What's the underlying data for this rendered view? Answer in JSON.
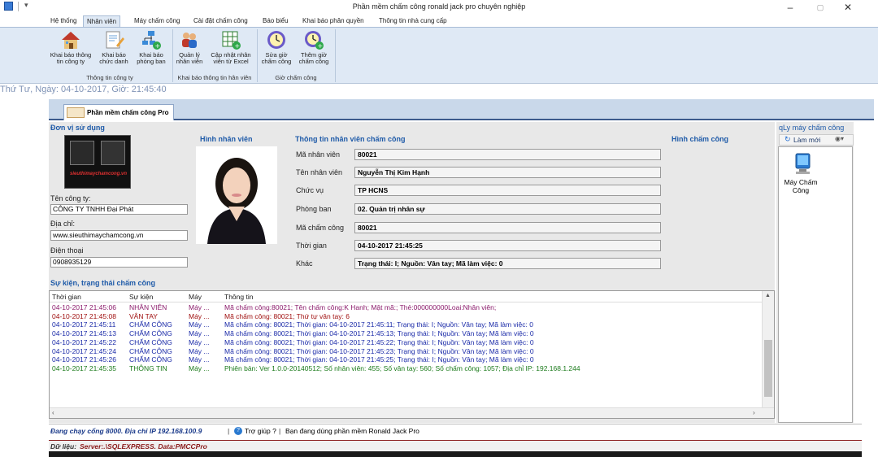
{
  "window": {
    "title": "Phần mềm chấm công ronald jack pro chuyên nghiệp",
    "minimize": "–",
    "maximize": "▢",
    "close": "✕"
  },
  "ribbon_tabs": [
    "Hệ thống",
    "Nhân viên",
    "Máy chấm công",
    "Cài đặt chấm công",
    "Báo biểu",
    "Khai báo phân quyền",
    "Thông tin nhà cung cấp"
  ],
  "ribbon": {
    "groups": [
      {
        "label": "Thông tin công ty",
        "buttons": [
          {
            "label1": "Khai báo thông",
            "label2": "tin công ty",
            "icon": "house-icon"
          },
          {
            "label1": "Khai báo",
            "label2": "chức danh",
            "icon": "edit-doc-icon"
          },
          {
            "label1": "Khai báo",
            "label2": "phòng ban",
            "icon": "org-chart-icon"
          }
        ]
      },
      {
        "label": "Khai báo thông tin hân viên",
        "buttons": [
          {
            "label1": "Quản lý",
            "label2": "nhân viên",
            "icon": "people-icon"
          },
          {
            "label1": "Cập nhật nhân",
            "label2": "viên từ Excel",
            "icon": "excel-icon"
          }
        ]
      },
      {
        "label": "Giờ chấm công",
        "buttons": [
          {
            "label1": "Sửa giờ",
            "label2": "chấm công",
            "icon": "clock-edit-icon"
          },
          {
            "label1": "Thêm giờ",
            "label2": "chấm công",
            "icon": "clock-add-icon"
          }
        ]
      }
    ]
  },
  "datetime": "Thứ Tư, Ngày: 04-10-2017, Giờ: 21:45:40",
  "doc_tab": "Phần mềm chấm công Pro",
  "company": {
    "section_title": "Đơn vị sử dụng",
    "logo_caption": "sieuthimaychamcong.vn",
    "name_label": "Tên công ty:",
    "name": "CÔNG TY TNHH Đại Phát",
    "address_label": "Địa chỉ:",
    "address": "www.sieuthimaychamcong.vn",
    "phone_label": "Điện thoại",
    "phone": "0908935129"
  },
  "employee_photo_title": "Hình nhân viên",
  "info": {
    "title": "Thông tin nhân viên chấm công",
    "fields": [
      {
        "label": "Mã nhân viên",
        "value": "80021"
      },
      {
        "label": "Tên nhân viên",
        "value": "Nguyễn Thị Kim Hạnh"
      },
      {
        "label": "Chức vụ",
        "value": "TP HCNS"
      },
      {
        "label": "Phòng ban",
        "value": "02. Quản trị nhân sự"
      },
      {
        "label": "Mã chấm công",
        "value": "80021"
      },
      {
        "label": "Thời gian",
        "value": "04-10-2017 21:45:25"
      },
      {
        "label": "Khác",
        "value": "Trạng thái: I; Nguồn: Vân tay; Mã làm việc: 0"
      }
    ]
  },
  "punch_image_title": "Hình chấm công",
  "events": {
    "title": "Sự kiện, trạng thái chấm công",
    "columns": [
      "Thời gian",
      "Sự kiện",
      "Máy",
      "Thông tin"
    ],
    "rows": [
      {
        "time": "04-10-2017 21:45:06",
        "event": "NHÂN VIÊN",
        "machine": "Máy ...",
        "info": "Mã chấm công:80021; Tên chấm công:K Hanh; Mật mã:; Thẻ:000000000Loai:Nhân viên;",
        "color": "#8b1a6b"
      },
      {
        "time": "04-10-2017 21:45:08",
        "event": "VÂN TAY",
        "machine": "Máy ...",
        "info": "Mã chấm công: 80021; Thứ tự vân tay: 6",
        "color": "#a01010"
      },
      {
        "time": "04-10-2017 21:45:11",
        "event": "CHẤM CÔNG",
        "machine": "Máy ...",
        "info": "Mã chấm công: 80021; Thời gian: 04-10-2017 21:45:11; Trạng thái: I; Nguồn: Vân tay; Mã làm việc: 0",
        "color": "#1a2aa8"
      },
      {
        "time": "04-10-2017 21:45:13",
        "event": "CHẤM CÔNG",
        "machine": "Máy ...",
        "info": "Mã chấm công: 80021; Thời gian: 04-10-2017 21:45:13; Trạng thái: I; Nguồn: Vân tay; Mã làm việc: 0",
        "color": "#1a2aa8"
      },
      {
        "time": "04-10-2017 21:45:22",
        "event": "CHẤM CÔNG",
        "machine": "Máy ...",
        "info": "Mã chấm công: 80021; Thời gian: 04-10-2017 21:45:22; Trạng thái: I; Nguồn: Vân tay; Mã làm việc: 0",
        "color": "#1a2aa8"
      },
      {
        "time": "04-10-2017 21:45:24",
        "event": "CHẤM CÔNG",
        "machine": "Máy ...",
        "info": "Mã chấm công: 80021; Thời gian: 04-10-2017 21:45:23; Trạng thái: I; Nguồn: Vân tay; Mã làm việc: 0",
        "color": "#1a2aa8"
      },
      {
        "time": "04-10-2017 21:45:26",
        "event": "CHẤM CÔNG",
        "machine": "Máy ...",
        "info": "Mã chấm công: 80021; Thời gian: 04-10-2017 21:45:25; Trạng thái: I; Nguồn: Vân tay; Mã làm việc: 0",
        "color": "#1a2aa8"
      },
      {
        "time": "04-10-2017 21:45:35",
        "event": "THÔNG TIN",
        "machine": "Máy ...",
        "info": "Phiên bản: Ver 1.0.0-20140512; Số nhân viên: 455; Số vân tay: 560; Số chấm công: 1057; Địa chỉ IP: 192.168.1.244",
        "color": "#1a7a1a"
      }
    ]
  },
  "machines": {
    "title": "qLy máy chấm công",
    "refresh": "Làm mới",
    "item": "Máy Chấm Công"
  },
  "status": {
    "running": "Đang chạy cổng 8000. Địa chỉ IP 192.168.100.9",
    "help": "Trợ giúp ?",
    "usage": "Bạn đang dùng phần mềm Ronald Jack Pro",
    "data_label": "Dữ liệu:",
    "data_value": "Server:.\\SQLEXPRESS. Data:PMCCPro"
  }
}
